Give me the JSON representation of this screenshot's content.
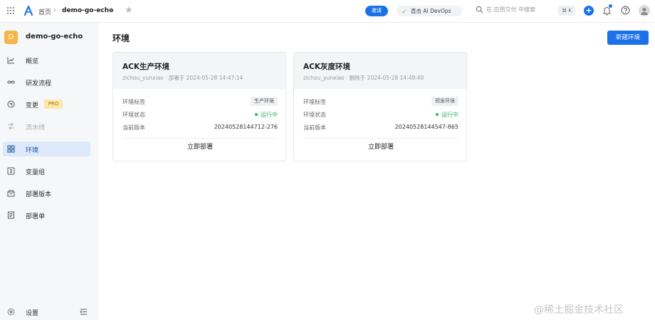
{
  "topbar": {
    "breadcrumb_home": "首页",
    "breadcrumb_sep": "›",
    "breadcrumb_app": "demo-go-echo",
    "invite_label": "邀请",
    "ai_label": "直击 AI DevOps",
    "search_placeholder": "在 应用交付 中搜索",
    "shortcut": "⌘ K",
    "plus": "+"
  },
  "sidebar": {
    "project_initial": "D",
    "project_name": "demo-go-echo",
    "items": [
      {
        "label": "概览",
        "icon": "chart-line-icon"
      },
      {
        "label": "研发流程",
        "icon": "infinity-icon"
      },
      {
        "label": "变更",
        "icon": "branch-icon",
        "badge": "PRO"
      },
      {
        "label": "流水线",
        "icon": "pipeline-icon",
        "disabled": true
      },
      {
        "label": "环境",
        "icon": "grid-icon",
        "active": true
      },
      {
        "label": "变量组",
        "icon": "variable-icon"
      },
      {
        "label": "部署版本",
        "icon": "package-icon"
      },
      {
        "label": "部署单",
        "icon": "document-icon"
      }
    ],
    "settings_label": "设置"
  },
  "main": {
    "title": "环境",
    "new_button": "新建环境",
    "cards": [
      {
        "title": "ACK生产环境",
        "meta": "zichou_yunxiao · 部署于 2024-05-28 14:47:14",
        "tag_key": "环境标签",
        "tag_value": "生产环境",
        "status_key": "环境状态",
        "status_value": "运行中",
        "version_key": "当前版本",
        "version_value": "20240528144712-276",
        "action": "立即部署"
      },
      {
        "title": "ACK灰度环境",
        "meta": "zichou_yunxiao · 删除于 2024-05-28 14:49:40",
        "tag_key": "环境标签",
        "tag_value": "预发环境",
        "status_key": "环境状态",
        "status_value": "运行中",
        "version_key": "当前版本",
        "version_value": "20240528144547-865",
        "action": "立即部署"
      }
    ]
  },
  "watermark": "@稀土掘金技术社区",
  "colors": {
    "accent": "#1b72e8",
    "status_running": "#34b36a",
    "project_avatar": "#f5b54a",
    "active_nav_bg": "#dde9fb"
  }
}
